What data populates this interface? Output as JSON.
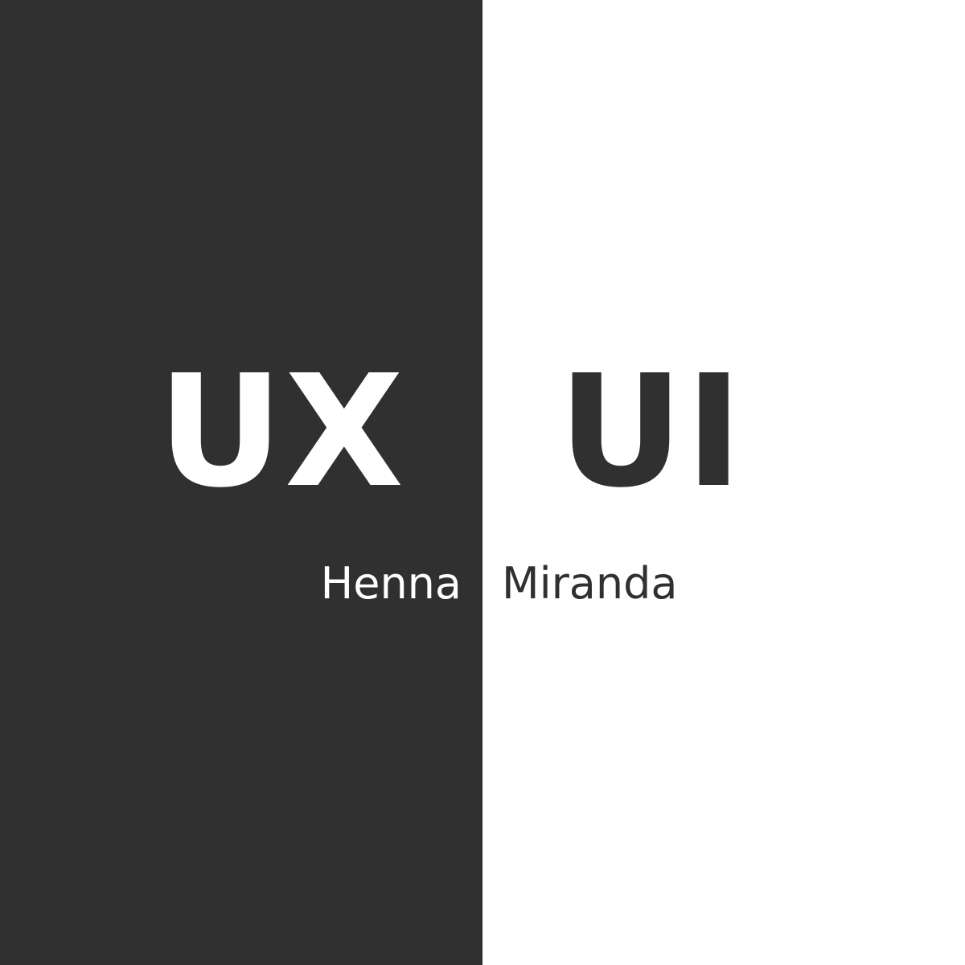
{
  "left": {
    "heading": "UX",
    "name": "Henna",
    "background": "#303030",
    "text_color": "#ffffff"
  },
  "right": {
    "heading": "UI",
    "name": "Miranda",
    "background": "#ffffff",
    "text_color": "#303030"
  }
}
